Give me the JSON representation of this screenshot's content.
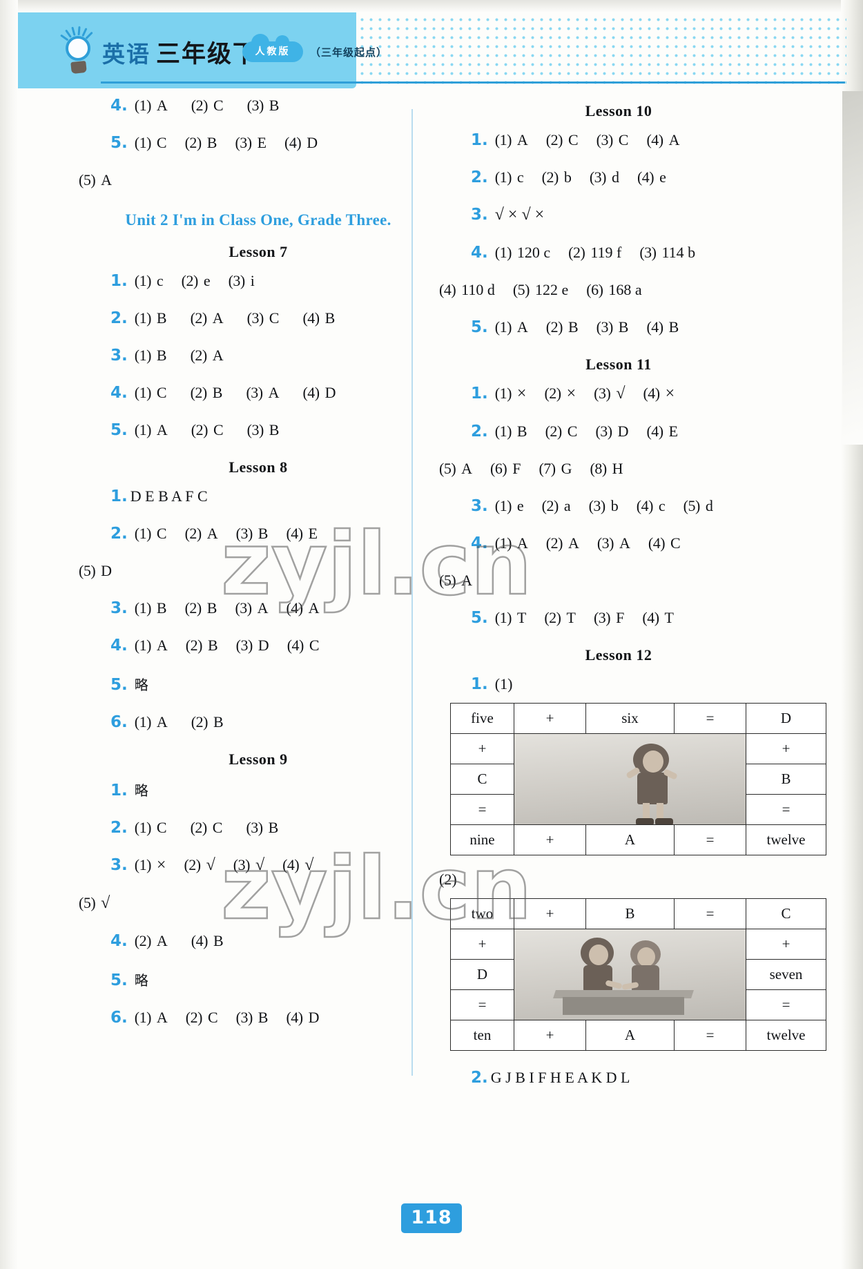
{
  "header": {
    "subject": "英语",
    "grade": "三年级下",
    "edition_badge": "人教版",
    "start_note": "（三年级起点）",
    "bulb_icon": "lightbulb-icon",
    "accent_color": "#2e9ede",
    "band_color": "#7cd2f0"
  },
  "page": {
    "number": "118",
    "watermark": "zyjl.cn"
  },
  "left_column": {
    "top_answers": [
      {
        "num": "4.",
        "items": [
          {
            "label": "(1)",
            "value": "A"
          },
          {
            "label": "(2)",
            "value": "C"
          },
          {
            "label": "(3)",
            "value": "B"
          }
        ]
      },
      {
        "num": "5.",
        "items": [
          {
            "label": "(1)",
            "value": "C"
          },
          {
            "label": "(2)",
            "value": "B"
          },
          {
            "label": "(3)",
            "value": "E"
          },
          {
            "label": "(4)",
            "value": "D"
          }
        ]
      }
    ],
    "top_continuation": [
      {
        "label": "(5)",
        "value": "A"
      }
    ],
    "unit_title": "Unit 2   I'm in Class One, Grade Three.",
    "lessons": [
      {
        "title": "Lesson 7",
        "answers": [
          {
            "num": "1.",
            "items": [
              {
                "label": "(1)",
                "value": "c"
              },
              {
                "label": "(2)",
                "value": "e"
              },
              {
                "label": "(3)",
                "value": "i"
              }
            ]
          },
          {
            "num": "2.",
            "items": [
              {
                "label": "(1)",
                "value": "B"
              },
              {
                "label": "(2)",
                "value": "A"
              },
              {
                "label": "(3)",
                "value": "C"
              },
              {
                "label": "(4)",
                "value": "B"
              }
            ]
          },
          {
            "num": "3.",
            "items": [
              {
                "label": "(1)",
                "value": "B"
              },
              {
                "label": "(2)",
                "value": "A"
              }
            ]
          },
          {
            "num": "4.",
            "items": [
              {
                "label": "(1)",
                "value": "C"
              },
              {
                "label": "(2)",
                "value": "B"
              },
              {
                "label": "(3)",
                "value": "A"
              },
              {
                "label": "(4)",
                "value": "D"
              }
            ]
          },
          {
            "num": "5.",
            "items": [
              {
                "label": "(1)",
                "value": "A"
              },
              {
                "label": "(2)",
                "value": "C"
              },
              {
                "label": "(3)",
                "value": "B"
              }
            ]
          }
        ]
      },
      {
        "title": "Lesson 8",
        "answers": [
          {
            "num": "1.",
            "sequence": "D  E  B  A  F  C"
          },
          {
            "num": "2.",
            "items": [
              {
                "label": "(1)",
                "value": "C"
              },
              {
                "label": "(2)",
                "value": "A"
              },
              {
                "label": "(3)",
                "value": "B"
              },
              {
                "label": "(4)",
                "value": "E"
              }
            ]
          },
          {
            "num": "",
            "continuation": [
              {
                "label": "(5)",
                "value": "D"
              }
            ]
          },
          {
            "num": "3.",
            "items": [
              {
                "label": "(1)",
                "value": "B"
              },
              {
                "label": "(2)",
                "value": "B"
              },
              {
                "label": "(3)",
                "value": "A"
              },
              {
                "label": "(4)",
                "value": "A"
              }
            ]
          },
          {
            "num": "4.",
            "items": [
              {
                "label": "(1)",
                "value": "A"
              },
              {
                "label": "(2)",
                "value": "B"
              },
              {
                "label": "(3)",
                "value": "D"
              },
              {
                "label": "(4)",
                "value": "C"
              }
            ]
          },
          {
            "num": "5.",
            "text": "略"
          },
          {
            "num": "6.",
            "items": [
              {
                "label": "(1)",
                "value": "A"
              },
              {
                "label": "(2)",
                "value": "B"
              }
            ]
          }
        ]
      },
      {
        "title": "Lesson 9",
        "answers": [
          {
            "num": "1.",
            "text": "略"
          },
          {
            "num": "2.",
            "items": [
              {
                "label": "(1)",
                "value": "C"
              },
              {
                "label": "(2)",
                "value": "C"
              },
              {
                "label": "(3)",
                "value": "B"
              }
            ]
          },
          {
            "num": "3.",
            "items": [
              {
                "label": "(1)",
                "value": "×"
              },
              {
                "label": "(2)",
                "value": "√"
              },
              {
                "label": "(3)",
                "value": "√"
              },
              {
                "label": "(4)",
                "value": "√"
              }
            ]
          },
          {
            "num": "",
            "continuation": [
              {
                "label": "(5)",
                "value": "√"
              }
            ]
          },
          {
            "num": "4.",
            "items": [
              {
                "label": "(2)",
                "value": "A"
              },
              {
                "label": "(4)",
                "value": "B"
              }
            ]
          },
          {
            "num": "5.",
            "text": "略"
          },
          {
            "num": "6.",
            "items": [
              {
                "label": "(1)",
                "value": "A"
              },
              {
                "label": "(2)",
                "value": "C"
              },
              {
                "label": "(3)",
                "value": "B"
              },
              {
                "label": "(4)",
                "value": "D"
              }
            ]
          }
        ]
      }
    ]
  },
  "right_column": {
    "lessons": [
      {
        "title": "Lesson 10",
        "answers": [
          {
            "num": "1.",
            "items": [
              {
                "label": "(1)",
                "value": "A"
              },
              {
                "label": "(2)",
                "value": "C"
              },
              {
                "label": "(3)",
                "value": "C"
              },
              {
                "label": "(4)",
                "value": "A"
              }
            ]
          },
          {
            "num": "2.",
            "items": [
              {
                "label": "(1)",
                "value": "c"
              },
              {
                "label": "(2)",
                "value": "b"
              },
              {
                "label": "(3)",
                "value": "d"
              },
              {
                "label": "(4)",
                "value": "e"
              }
            ]
          },
          {
            "num": "3.",
            "marks": "√   ×   √   ×"
          },
          {
            "num": "4.",
            "items": [
              {
                "label": "(1)",
                "value": "120  c"
              },
              {
                "label": "(2)",
                "value": "119  f"
              },
              {
                "label": "(3)",
                "value": "114  b"
              }
            ]
          },
          {
            "num": "",
            "continuation": [
              {
                "label": "(4)",
                "value": "110  d"
              },
              {
                "label": "(5)",
                "value": "122  e"
              },
              {
                "label": "(6)",
                "value": "168  a"
              }
            ]
          },
          {
            "num": "5.",
            "items": [
              {
                "label": "(1)",
                "value": "A"
              },
              {
                "label": "(2)",
                "value": "B"
              },
              {
                "label": "(3)",
                "value": "B"
              },
              {
                "label": "(4)",
                "value": "B"
              }
            ]
          }
        ]
      },
      {
        "title": "Lesson 11",
        "answers": [
          {
            "num": "1.",
            "items": [
              {
                "label": "(1)",
                "value": "×"
              },
              {
                "label": "(2)",
                "value": "×"
              },
              {
                "label": "(3)",
                "value": "√"
              },
              {
                "label": "(4)",
                "value": "×"
              }
            ]
          },
          {
            "num": "2.",
            "items": [
              {
                "label": "(1)",
                "value": "B"
              },
              {
                "label": "(2)",
                "value": "C"
              },
              {
                "label": "(3)",
                "value": "D"
              },
              {
                "label": "(4)",
                "value": "E"
              }
            ]
          },
          {
            "num": "",
            "continuation": [
              {
                "label": "(5)",
                "value": "A"
              },
              {
                "label": "(6)",
                "value": "F"
              },
              {
                "label": "(7)",
                "value": "G"
              },
              {
                "label": "(8)",
                "value": "H"
              }
            ]
          },
          {
            "num": "3.",
            "items": [
              {
                "label": "(1)",
                "value": "e"
              },
              {
                "label": "(2)",
                "value": "a"
              },
              {
                "label": "(3)",
                "value": "b"
              },
              {
                "label": "(4)",
                "value": "c"
              },
              {
                "label": "(5)",
                "value": "d"
              }
            ]
          },
          {
            "num": "4.",
            "items": [
              {
                "label": "(1)",
                "value": "A"
              },
              {
                "label": "(2)",
                "value": "A"
              },
              {
                "label": "(3)",
                "value": "A"
              },
              {
                "label": "(4)",
                "value": "C"
              }
            ]
          },
          {
            "num": "",
            "continuation": [
              {
                "label": "(5)",
                "value": "A"
              }
            ]
          },
          {
            "num": "5.",
            "items": [
              {
                "label": "(1)",
                "value": "T"
              },
              {
                "label": "(2)",
                "value": "T"
              },
              {
                "label": "(3)",
                "value": "F"
              },
              {
                "label": "(4)",
                "value": "T"
              }
            ]
          }
        ]
      },
      {
        "title": "Lesson 12",
        "q1_num": "1.",
        "q1_sub1": "(1)",
        "q1_sub2": "(2)",
        "table1": {
          "rows": [
            [
              "five",
              "+",
              "six",
              "=",
              "D"
            ],
            [
              "+",
              "PIC",
              "+"
            ],
            [
              "C",
              "PIC",
              "B"
            ],
            [
              "=",
              "PIC",
              "="
            ],
            [
              "nine",
              "+",
              "A",
              "=",
              "twelve"
            ]
          ],
          "picture": "girl-skipping-illustration"
        },
        "table2": {
          "rows": [
            [
              "two",
              "+",
              "B",
              "=",
              "C"
            ],
            [
              "+",
              "PIC",
              "+"
            ],
            [
              "D",
              "PIC",
              "seven"
            ],
            [
              "=",
              "PIC",
              "="
            ],
            [
              "ten",
              "+",
              "A",
              "=",
              "twelve"
            ]
          ],
          "picture": "two-children-at-desk-illustration"
        },
        "q2_num": "2.",
        "q2_sequence": "G  J  B  I  F  H  E  A  K  D  L"
      }
    ]
  }
}
